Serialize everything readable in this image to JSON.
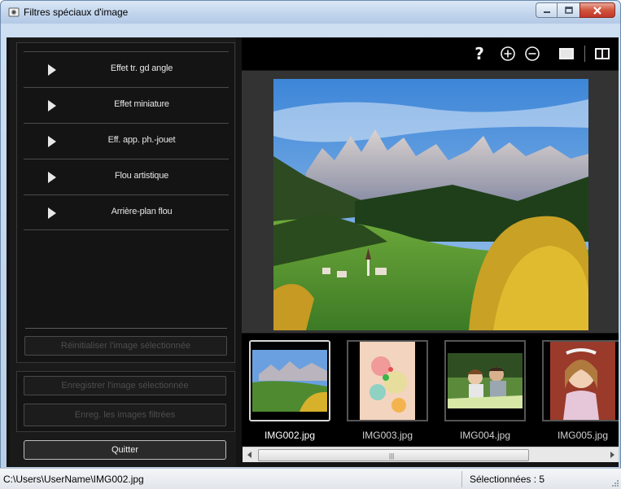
{
  "window": {
    "title": "Filtres spéciaux d'image"
  },
  "filters": [
    {
      "label": "Effet tr. gd angle"
    },
    {
      "label": "Effet miniature"
    },
    {
      "label": "Eff. app. ph.-jouet"
    },
    {
      "label": "Flou artistique"
    },
    {
      "label": "Arrière-plan flou"
    }
  ],
  "buttons": {
    "reset": "Réinitialiser l'image sélectionnée",
    "save_selected": "Enregistrer l'image sélectionnée",
    "save_filtered": "Enreg. les images filtrées",
    "quit": "Quitter"
  },
  "toolbar": {
    "help": "?",
    "icons": [
      "help-icon",
      "zoom-in-icon",
      "zoom-out-icon",
      "full-screen-icon",
      "compare-view-icon"
    ]
  },
  "thumbnails": [
    {
      "name": "IMG002.jpg",
      "selected": true
    },
    {
      "name": "IMG003.jpg",
      "selected": false
    },
    {
      "name": "IMG004.jpg",
      "selected": false
    },
    {
      "name": "IMG005.jpg",
      "selected": false
    }
  ],
  "status": {
    "path": "C:\\Users\\UserName\\IMG002.jpg",
    "selected": "Sélectionnées : 5"
  },
  "colors": {
    "panel_bg": "#141414",
    "preview_bg": "#333333",
    "title_bar": "#c4d7ee",
    "close_button": "#c1362a"
  }
}
